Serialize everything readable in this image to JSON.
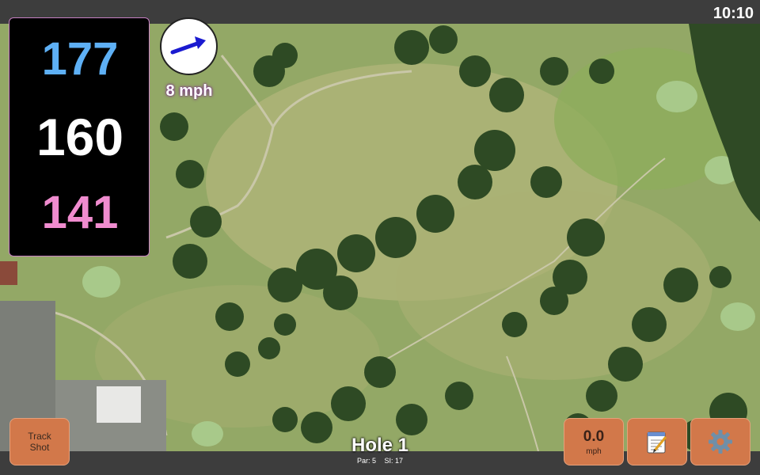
{
  "status": {
    "time": "10:10"
  },
  "distances": {
    "back": "177",
    "middle": "160",
    "front": "141"
  },
  "wind": {
    "speed": "8 mph",
    "direction_icon": "arrow-right-icon"
  },
  "hole": {
    "title": "Hole 1",
    "par": "Par: 5",
    "stroke_index": "SI: 17"
  },
  "buttons": {
    "track_shot": "Track Shot",
    "speed_value": "0.0",
    "speed_unit": "mph",
    "notes_icon": "notepad-icon",
    "settings_icon": "gear-icon"
  },
  "colors": {
    "back_distance": "#5eb0f5",
    "middle_distance": "#ffffff",
    "front_distance": "#f08ccf",
    "button_accent": "#d2784a",
    "wind_arrow": "#1a1ad0"
  }
}
